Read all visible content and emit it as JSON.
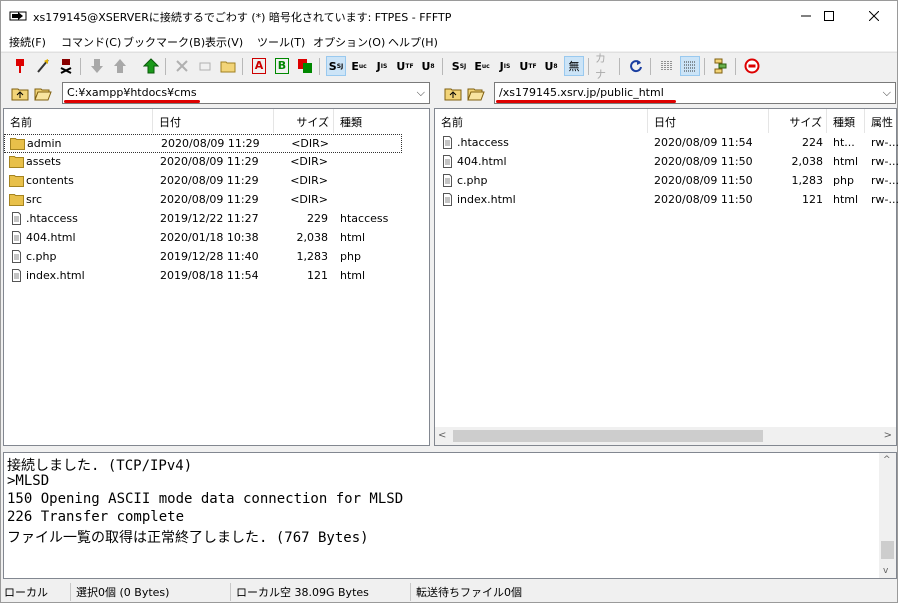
{
  "window": {
    "title": "xs179145@XSERVERに接続するでごわす (*) 暗号化されています: FTPES - FFFTP",
    "minimize_icon": "minimize-icon",
    "maximize_icon": "maximize-icon",
    "close_icon": "close-icon"
  },
  "menu": [
    {
      "label": "接続(F)"
    },
    {
      "label": "コマンド(C)"
    },
    {
      "label": "ブックマーク(B)"
    },
    {
      "label": "表示(V)"
    },
    {
      "label": "ツール(T)"
    },
    {
      "label": "オプション(O)"
    },
    {
      "label": "ヘルプ(H)"
    }
  ],
  "toolbar": {
    "connect_icon": "connect-icon",
    "quick_connect_icon": "quick-connect-icon",
    "disconnect_icon": "disconnect-icon",
    "download_icon": "download-icon",
    "upload_icon": "upload-icon",
    "mirror_upload_icon": "mirror-upload-icon",
    "delete_icon": "delete-icon",
    "rename_icon": "rename-icon",
    "mkdir_icon": "make-directory-icon",
    "ascii_label": "A",
    "binary_label": "B",
    "auto_icon": "auto-mode-icon",
    "local_kanji": [
      "S",
      "E",
      "J",
      "U",
      "U"
    ],
    "remote_kanji": [
      "S",
      "E",
      "J",
      "U",
      "U"
    ],
    "none_label": "無",
    "kana_label": "カナ",
    "refresh_icon": "refresh-icon",
    "list_icon": "list-view-icon",
    "detail_icon": "detail-view-icon",
    "sync_icon": "sync-icon",
    "stop_icon": "stop-icon"
  },
  "local": {
    "path": "C:¥xampp¥htdocs¥cms",
    "columns": [
      "名前",
      "日付",
      "サイズ",
      "種類"
    ],
    "files": [
      {
        "name": "admin",
        "date": "2020/08/09 11:29",
        "size": "<DIR>",
        "type": "",
        "kind": "folder"
      },
      {
        "name": "assets",
        "date": "2020/08/09 11:29",
        "size": "<DIR>",
        "type": "",
        "kind": "folder"
      },
      {
        "name": "contents",
        "date": "2020/08/09 11:29",
        "size": "<DIR>",
        "type": "",
        "kind": "folder"
      },
      {
        "name": "src",
        "date": "2020/08/09 11:29",
        "size": "<DIR>",
        "type": "",
        "kind": "folder"
      },
      {
        "name": ".htaccess",
        "date": "2019/12/22 11:27",
        "size": "229",
        "type": "htaccess",
        "kind": "file"
      },
      {
        "name": "404.html",
        "date": "2020/01/18 10:38",
        "size": "2,038",
        "type": "html",
        "kind": "file"
      },
      {
        "name": "c.php",
        "date": "2019/12/28 11:40",
        "size": "1,283",
        "type": "php",
        "kind": "file"
      },
      {
        "name": "index.html",
        "date": "2019/08/18 11:54",
        "size": "121",
        "type": "html",
        "kind": "file"
      }
    ]
  },
  "remote": {
    "path": "/xs179145.xsrv.jp/public_html",
    "columns": [
      "名前",
      "日付",
      "サイズ",
      "種類",
      "属性"
    ],
    "files": [
      {
        "name": ".htaccess",
        "date": "2020/08/09 11:54",
        "size": "224",
        "type": "ht...",
        "attr": "rw-..."
      },
      {
        "name": "404.html",
        "date": "2020/08/09 11:50",
        "size": "2,038",
        "type": "html",
        "attr": "rw-..."
      },
      {
        "name": "c.php",
        "date": "2020/08/09 11:50",
        "size": "1,283",
        "type": "php",
        "attr": "rw-..."
      },
      {
        "name": "index.html",
        "date": "2020/08/09 11:50",
        "size": "121",
        "type": "html",
        "attr": "rw-..."
      }
    ]
  },
  "log": [
    "接続しました. (TCP/IPv4)",
    ">MLSD",
    "150 Opening ASCII mode data connection for MLSD",
    "226 Transfer complete",
    "ファイル一覧の取得は正常終了しました. (767 Bytes)"
  ],
  "status": {
    "local_label": "ローカル",
    "selection": "選択0個 (0 Bytes)",
    "local_free": "ローカル空 38.09G Bytes",
    "queue": "転送待ちファイル0個"
  },
  "colors": {
    "highlight": "#d00000",
    "folder": "#e8c04a",
    "accent": "#cce4f7"
  }
}
